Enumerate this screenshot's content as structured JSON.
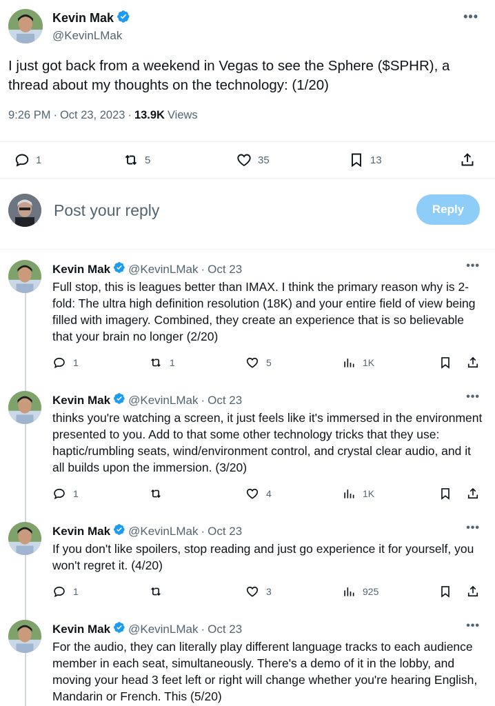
{
  "main": {
    "author_name": "Kevin Mak",
    "author_handle": "@KevinLMak",
    "text": "I just got back from a weekend in Vegas to see the Sphere ($SPHR), a thread about my thoughts on the technology: (1/20)",
    "time": "9:26 PM",
    "date": "Oct 23, 2023",
    "views": "13.9K",
    "views_label": "Views",
    "replies": "1",
    "reposts": "5",
    "likes": "35",
    "bookmarks": "13",
    "more_icon": "more-horizontal-icon"
  },
  "composer": {
    "placeholder": "Post your reply",
    "button_label": "Reply"
  },
  "thread": [
    {
      "author_name": "Kevin Mak",
      "author_handle": "@KevinLMak",
      "dot": "·",
      "date": "Oct 23",
      "text": "Full stop, this is leagues better than IMAX. I think the primary reason why is 2-fold: The ultra high definition resolution (18K) and your entire field of view being filled with imagery. Combined, they create an experience that is so believable that your brain no longer  (2/20)",
      "replies": "1",
      "reposts": "1",
      "likes": "5",
      "views": "1K"
    },
    {
      "author_name": "Kevin Mak",
      "author_handle": "@KevinLMak",
      "dot": "·",
      "date": "Oct 23",
      "text": "thinks you're watching a screen, it just feels like it's immersed in the environment presented to you. Add to that some other technology tricks that they use: haptic/rumbling seats, wind/environment control, and crystal clear audio, and it all builds upon the immersion.  (3/20)",
      "replies": "1",
      "reposts": "",
      "likes": "4",
      "views": "1K"
    },
    {
      "author_name": "Kevin Mak",
      "author_handle": "@KevinLMak",
      "dot": "·",
      "date": "Oct 23",
      "text": "If you don't like spoilers, stop reading and just go experience it for yourself, you won't regret it. (4/20)",
      "replies": "1",
      "reposts": "",
      "likes": "3",
      "views": "925"
    },
    {
      "author_name": "Kevin Mak",
      "author_handle": "@KevinLMak",
      "dot": "·",
      "date": "Oct 23",
      "text": "For the audio, they can literally play different language tracks to each audience member in each seat, simultaneously. There's a demo of it in the lobby, and moving your head 3 feet left or right will change whether you're hearing English, Mandarin or French. This  (5/20)"
    }
  ],
  "colors": {
    "accent": "#1d9bf0",
    "reply_button": "#8ecdf8",
    "muted_text": "#536471",
    "divider": "#eff3f4"
  }
}
